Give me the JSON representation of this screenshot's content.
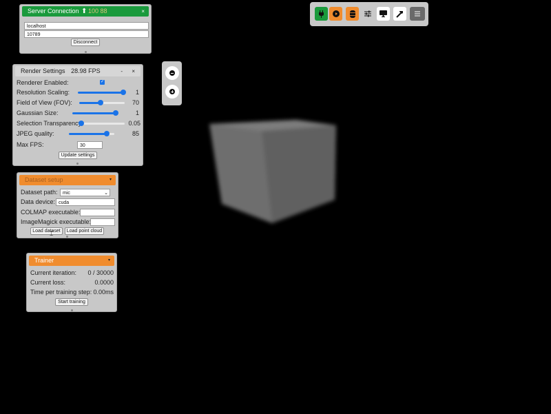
{
  "server_connection": {
    "title": "Server Connection",
    "overlay_text": "100 88",
    "host": "localhost",
    "port": "10789",
    "disconnect_label": "Disconnect",
    "header_color": "#1a9a3c"
  },
  "render_settings": {
    "title": "Render Settings",
    "fps": "28.98 FPS",
    "renderer_enabled_label": "Renderer Enabled:",
    "renderer_enabled": true,
    "resolution_label": "Resolution Scaling:",
    "resolution_value": "1",
    "resolution_level": 1.0,
    "fov_label": "Field of View (FOV):",
    "fov_value": "70",
    "fov_level": 0.47,
    "gaussian_label": "Gaussian Size:",
    "gaussian_value": "1",
    "gaussian_level": 0.95,
    "transparency_label": "Selection Transparency:",
    "transparency_value": "0.05",
    "transparency_level": 0.05,
    "jpeg_label": "JPEG quality:",
    "jpeg_value": "85",
    "jpeg_level": 0.83,
    "max_fps_label": "Max FPS:",
    "max_fps_value": "30",
    "update_label": "Update settings"
  },
  "dataset_setup": {
    "title": "Dataset setup",
    "dataset_path_label": "Dataset path:",
    "dataset_path_value": "mic",
    "data_device_label": "Data device:",
    "data_device_value": "cuda",
    "colmap_label": "COLMAP executable:",
    "colmap_value": "",
    "imagemagick_label": "ImageMagick executable:",
    "imagemagick_value": "",
    "load_dataset_label": "Load dataset",
    "load_point_cloud_label": "Load point cloud",
    "header_color": "#f08c2e"
  },
  "trainer": {
    "title": "Trainer",
    "iteration_label": "Current iteration:",
    "iteration_value": "0 / 30000",
    "loss_label": "Current loss:",
    "loss_value": "0.0000",
    "time_label": "Time per training step:",
    "time_value": "0.00ms",
    "start_label": "Start training",
    "header_color": "#f08c2e"
  },
  "toolbar": {
    "icons": [
      "plug-icon",
      "play-icon",
      "database-icon",
      "sliders-icon",
      "monitor-icon",
      "hammer-icon",
      "menu-icon"
    ],
    "colors": {
      "plug": "#1a9a3c",
      "play": "#f08c2e",
      "database": "#f08c2e"
    }
  },
  "zoom": {
    "icons": [
      "zoom-out-icon",
      "zoom-in-icon"
    ]
  }
}
